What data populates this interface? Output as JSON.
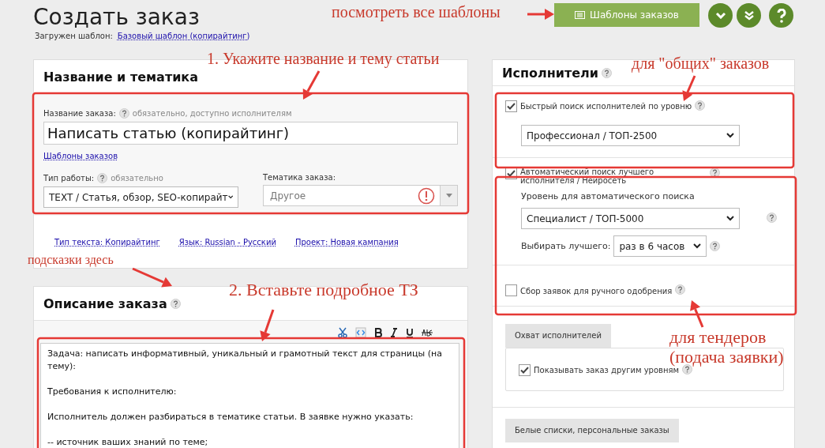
{
  "header": {
    "title": "Создать заказ",
    "template_label": "Загружен шаблон:",
    "template_link": "Базовый шаблон (копирайтинг)",
    "templates_button": "Шаблоны заказов"
  },
  "name_panel": {
    "title": "Название и тематика",
    "name_label": "Название заказа:",
    "name_hint": "обязательно, доступно исполнителям",
    "name_value": "Написать статью (копирайтинг)",
    "templates_link": "Шаблоны заказов",
    "work_type_label": "Тип работы:",
    "work_type_hint": "обязательно",
    "work_type_value": "TEXT / Статья, обзор, SEO-копирайт",
    "topic_label": "Тематика заказа:",
    "topic_placeholder": "Другое",
    "topic_error": true,
    "meta_links": [
      "Тип текста: Копирайтинг",
      "Язык: Russian - Русский",
      "Проект: Новая кампания"
    ]
  },
  "description_panel": {
    "title": "Описание заказа",
    "text": "Задача: написать информативный, уникальный и грамотный текст для страницы (на тему):\n\nТребования к исполнителю:\n\nИсполнитель должен разбираться в тематике статьи. В заявке нужно указать:\n\n-- источник ваших знаний по теме;"
  },
  "executors_panel": {
    "title": "Исполнители",
    "quick_search": {
      "label": "Быстрый поиск исполнителей по уровню",
      "checked": true,
      "level_value": "Профессионал / ТОП-2500"
    },
    "auto_search": {
      "label": "Автоматический поиск лучшего исполнителя / Нейросеть",
      "checked": true,
      "level_label": "Уровень для автоматического поиска",
      "level_value": "Специалист / ТОП-5000",
      "pick_label": "Выбирать лучшего:",
      "pick_value": "раз в 6 часов"
    },
    "manual": {
      "label": "Сбор заявок для ручного одобрения",
      "checked": false
    },
    "coverage_tab": "Охват исполнителей",
    "coverage_option": {
      "label": "Показывать заказ другим уровням",
      "checked": true
    },
    "whitelist_tab": "Белые списки, персональные заказы"
  },
  "annotations": [
    {
      "text": "посмотреть все шаблоны"
    },
    {
      "text": "1. Укажите название и тему статьи"
    },
    {
      "text": "для \"общих\" заказов"
    },
    {
      "text": "подсказки здесь"
    },
    {
      "text": "2. Вставьте подробное ТЗ"
    },
    {
      "text": "для тендеров"
    },
    {
      "text": "(подача заявки)"
    }
  ]
}
